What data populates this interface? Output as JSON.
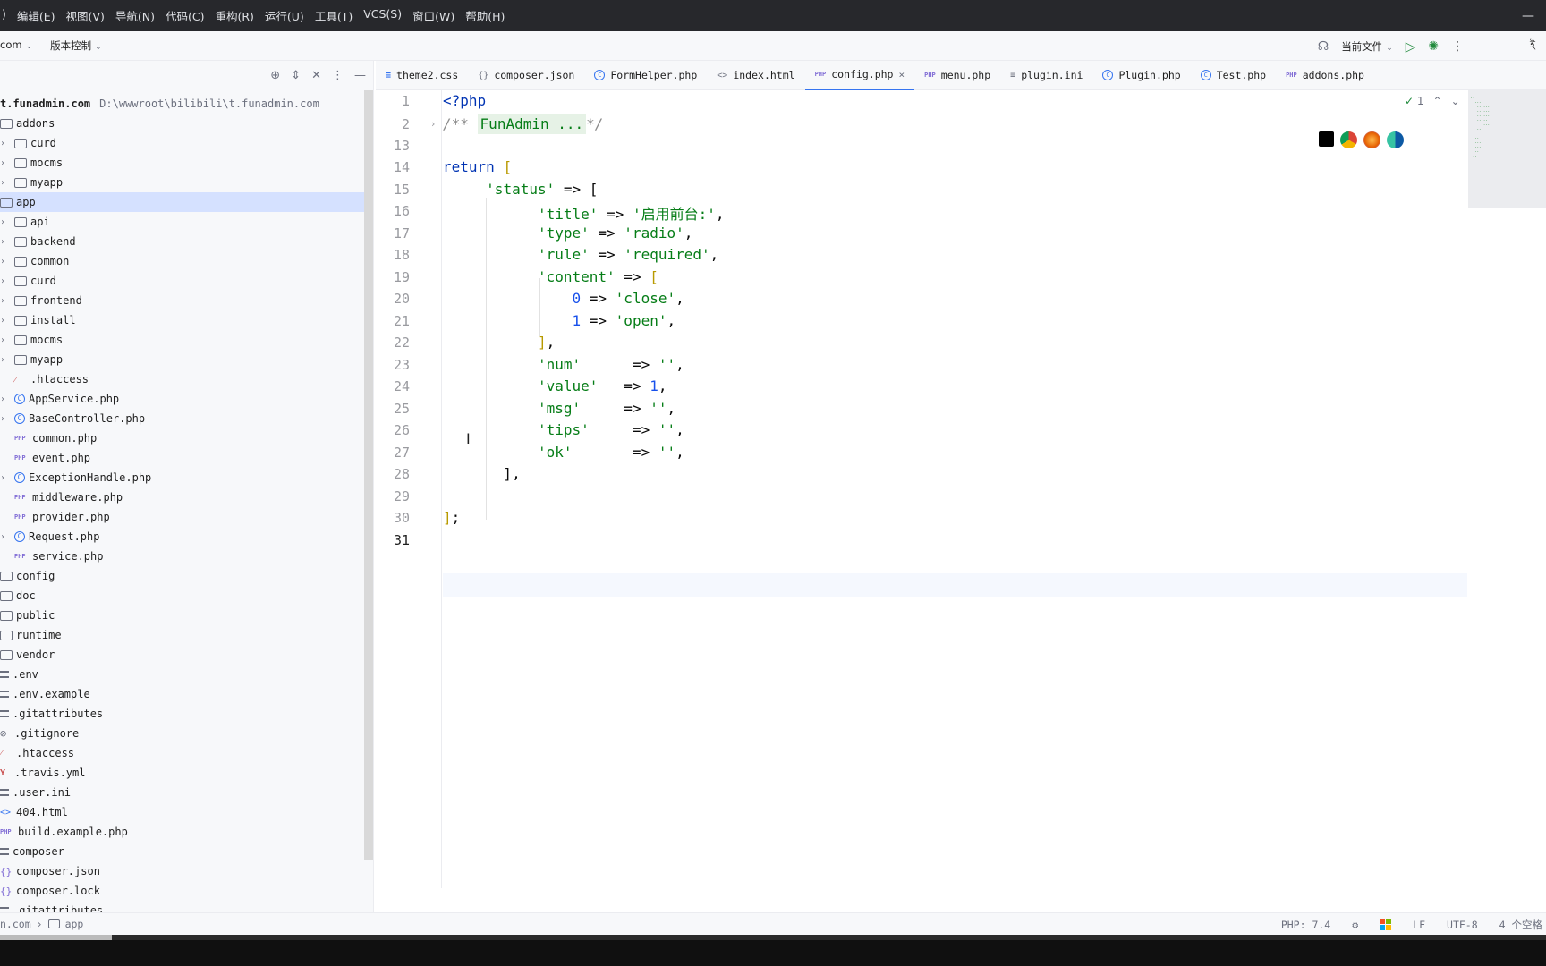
{
  "menu": {
    "items": [
      ")",
      "编辑(E)",
      "视图(V)",
      "导航(N)",
      "代码(C)",
      "重构(R)",
      "运行(U)",
      "工具(T)",
      "VCS(S)",
      "窗口(W)",
      "帮助(H)"
    ],
    "minimize": "—"
  },
  "toolbar": {
    "project": "com",
    "vcs": "版本控制",
    "run_config": "当前文件",
    "right_edge": "ই"
  },
  "project": {
    "root_name": "t.funadmin.com",
    "root_path": "D:\\wwwroot\\bilibili\\t.funadmin.com",
    "tree": [
      {
        "label": "addons",
        "icon": "folder",
        "indent": 0,
        "arrow": false
      },
      {
        "label": "curd",
        "icon": "folder",
        "indent": 1,
        "arrow": true
      },
      {
        "label": "mocms",
        "icon": "folder",
        "indent": 1,
        "arrow": true
      },
      {
        "label": "myapp",
        "icon": "folder",
        "indent": 1,
        "arrow": true
      },
      {
        "label": "app",
        "icon": "folder",
        "indent": 0,
        "arrow": false,
        "selected": true
      },
      {
        "label": "api",
        "icon": "folder",
        "indent": 1,
        "arrow": true
      },
      {
        "label": "backend",
        "icon": "folder",
        "indent": 1,
        "arrow": true
      },
      {
        "label": "common",
        "icon": "folder",
        "indent": 1,
        "arrow": true
      },
      {
        "label": "curd",
        "icon": "folder",
        "indent": 1,
        "arrow": true
      },
      {
        "label": "frontend",
        "icon": "folder",
        "indent": 1,
        "arrow": true
      },
      {
        "label": "install",
        "icon": "folder",
        "indent": 1,
        "arrow": true
      },
      {
        "label": "mocms",
        "icon": "folder",
        "indent": 1,
        "arrow": true
      },
      {
        "label": "myapp",
        "icon": "folder",
        "indent": 1,
        "arrow": true
      },
      {
        "label": ".htaccess",
        "icon": "htaccess",
        "indent": 1,
        "arrow": false
      },
      {
        "label": "AppService.php",
        "icon": "class",
        "indent": 1,
        "arrow": true
      },
      {
        "label": "BaseController.php",
        "icon": "class",
        "indent": 1,
        "arrow": true
      },
      {
        "label": "common.php",
        "icon": "php",
        "indent": 1,
        "arrow": false
      },
      {
        "label": "event.php",
        "icon": "php",
        "indent": 1,
        "arrow": false
      },
      {
        "label": "ExceptionHandle.php",
        "icon": "class",
        "indent": 1,
        "arrow": true
      },
      {
        "label": "middleware.php",
        "icon": "php",
        "indent": 1,
        "arrow": false
      },
      {
        "label": "provider.php",
        "icon": "php",
        "indent": 1,
        "arrow": false
      },
      {
        "label": "Request.php",
        "icon": "class",
        "indent": 1,
        "arrow": true
      },
      {
        "label": "service.php",
        "icon": "php",
        "indent": 1,
        "arrow": false
      },
      {
        "label": "config",
        "icon": "folder",
        "indent": 0,
        "arrow": false
      },
      {
        "label": "doc",
        "icon": "folder",
        "indent": 0,
        "arrow": false
      },
      {
        "label": "public",
        "icon": "folder",
        "indent": 0,
        "arrow": false
      },
      {
        "label": "runtime",
        "icon": "folder",
        "indent": 0,
        "arrow": false
      },
      {
        "label": "vendor",
        "icon": "folder",
        "indent": 0,
        "arrow": false
      },
      {
        "label": ".env",
        "icon": "lines",
        "indent": 0,
        "arrow": false
      },
      {
        "label": ".env.example",
        "icon": "lines",
        "indent": 0,
        "arrow": false
      },
      {
        "label": ".gitattributes",
        "icon": "lines",
        "indent": 0,
        "arrow": false
      },
      {
        "label": ".gitignore",
        "icon": "slash",
        "indent": 0,
        "arrow": false
      },
      {
        "label": ".htaccess",
        "icon": "htaccess",
        "indent": 0,
        "arrow": false
      },
      {
        "label": ".travis.yml",
        "icon": "yml",
        "indent": 0,
        "arrow": false
      },
      {
        "label": ".user.ini",
        "icon": "lines",
        "indent": 0,
        "arrow": false
      },
      {
        "label": "404.html",
        "icon": "html",
        "indent": 0,
        "arrow": false
      },
      {
        "label": "build.example.php",
        "icon": "php",
        "indent": 0,
        "arrow": false
      },
      {
        "label": "composer",
        "icon": "lines",
        "indent": 0,
        "arrow": false
      },
      {
        "label": "composer.json",
        "icon": "json",
        "indent": 0,
        "arrow": false
      },
      {
        "label": "composer.lock",
        "icon": "json",
        "indent": 0,
        "arrow": false
      },
      {
        "label": ".gitattributes",
        "icon": "lines",
        "indent": 0,
        "arrow": false
      }
    ]
  },
  "tabs": [
    {
      "label": "theme2.css",
      "icon": "css"
    },
    {
      "label": "composer.json",
      "icon": "json"
    },
    {
      "label": "FormHelper.php",
      "icon": "class"
    },
    {
      "label": "index.html",
      "icon": "html"
    },
    {
      "label": "config.php",
      "icon": "php",
      "active": true
    },
    {
      "label": "menu.php",
      "icon": "php"
    },
    {
      "label": "plugin.ini",
      "icon": "lines"
    },
    {
      "label": "Plugin.php",
      "icon": "class"
    },
    {
      "label": "Test.php",
      "icon": "class"
    },
    {
      "label": "addons.php",
      "icon": "php"
    }
  ],
  "editor": {
    "line_numbers": [
      "1",
      "2",
      "13",
      "14",
      "15",
      "16",
      "17",
      "18",
      "19",
      "20",
      "21",
      "22",
      "23",
      "24",
      "25",
      "26",
      "27",
      "28",
      "29",
      "30",
      "31"
    ],
    "current_line": "31",
    "inspection_count": "1",
    "code": {
      "l1": "<?php",
      "l2_open": "/**",
      "l2_fold": "FunAdmin ...",
      "l2_close": "*/",
      "l14_kw": "return",
      "l15_key": "'status'",
      "l16_key": "'title'",
      "l16_val": "'启用前台:'",
      "l17_key": "'type'",
      "l17_val": "'radio'",
      "l18_key": "'rule'",
      "l18_val": "'required'",
      "l19_key": "'content'",
      "l20_num": "0",
      "l20_val": "'close'",
      "l21_num": "1",
      "l21_val": "'open'",
      "l23_key": "'num'",
      "l23_val": "''",
      "l24_key": "'value'",
      "l24_num": "1",
      "l25_key": "'msg'",
      "l25_val": "''",
      "l26_key": "'tips'",
      "l26_val": "''",
      "l27_key": "'ok'",
      "l27_val": "''"
    }
  },
  "status": {
    "crumb_host": "n.com",
    "crumb_dir": "app",
    "php_version": "PHP: 7.4",
    "line_sep": "LF",
    "encoding": "UTF-8",
    "indent": "4 个空格"
  },
  "colors": {
    "accent": "#3574f0",
    "string": "#067d17",
    "keyword": "#0033b3",
    "number": "#1750eb"
  }
}
